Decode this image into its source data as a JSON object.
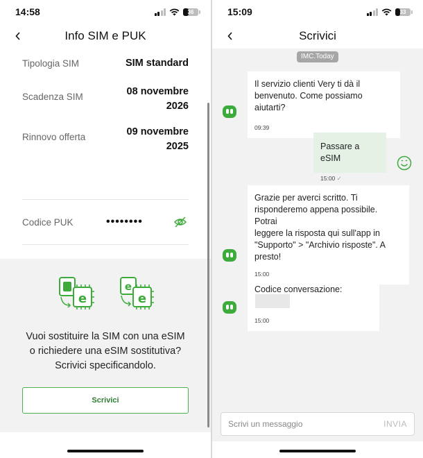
{
  "left": {
    "status_time": "14:58",
    "battery": "36",
    "battery_level": 0.36,
    "title": "Info SIM e PUK",
    "rows": [
      {
        "label": "Tipologia SIM",
        "value": "SIM standard",
        "value2": ""
      },
      {
        "label": "Scadenza SIM",
        "value": "08 novembre",
        "value2": "2026"
      },
      {
        "label": "Rinnovo offerta",
        "value": "09 novembre",
        "value2": "2025"
      }
    ],
    "puk": {
      "label": "Codice PUK",
      "value": "••••••••"
    },
    "promo_lines": [
      "Vuoi sostituire la SIM con una eSIM",
      "o richiedere una eSIM sostitutiva?",
      "Scrivici specificandolo."
    ],
    "cta_label": "Scrivici"
  },
  "right": {
    "status_time": "15:09",
    "battery": "33",
    "battery_level": 0.33,
    "title": "Scrivici",
    "tag": "IMC.Today",
    "messages": [
      {
        "lines": [
          "Il servizio clienti Very ti dà il",
          "benvenuto. Come possiamo aiutarti?"
        ],
        "time": "09:39"
      },
      {
        "lines": [
          "Passare a eSIM"
        ],
        "time": "15:00"
      },
      {
        "lines": [
          "Grazie per averci scritto. Ti",
          "risponderemo appena possibile. Potrai",
          "leggere la risposta qui sull'app in",
          "\"Supporto\" > \"Archivio risposte\". A",
          "presto!"
        ],
        "time": "15:00"
      },
      {
        "lines": [
          "Codice conversazione:"
        ],
        "time": "15:00"
      }
    ],
    "input_placeholder": "Scrivi un messaggio",
    "send_label": "INVIA"
  },
  "colors": {
    "brand_green": "#3cab3c",
    "outgoing_bubble": "#e5f1e5",
    "panel_gray": "#f2f2f2"
  }
}
